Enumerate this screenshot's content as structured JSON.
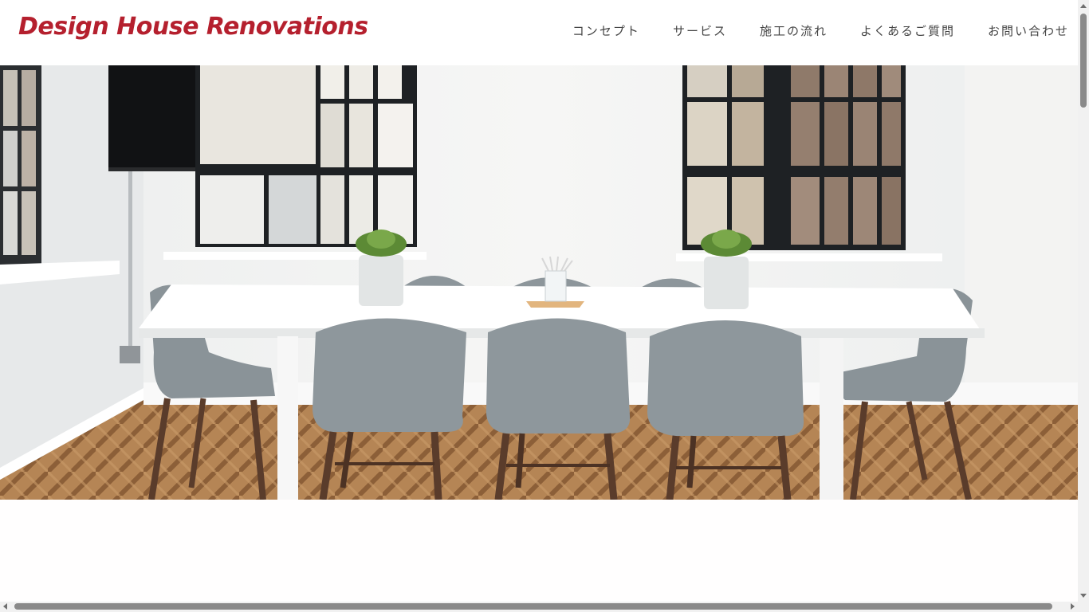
{
  "header": {
    "logo": "Design House Renovations",
    "nav": [
      {
        "label": "コンセプト"
      },
      {
        "label": "サービス"
      },
      {
        "label": "施工の流れ"
      },
      {
        "label": "よくあるご質問"
      },
      {
        "label": "お問い合わせ"
      }
    ]
  },
  "colors": {
    "brand": "#b5202e",
    "nav_text": "#444444",
    "background": "#ffffff"
  },
  "icons": {
    "hero": "dining-room-photo",
    "scroll_up": "arrow-up-icon",
    "scroll_down": "arrow-down-icon",
    "scroll_left": "arrow-left-icon",
    "scroll_right": "arrow-right-icon"
  }
}
